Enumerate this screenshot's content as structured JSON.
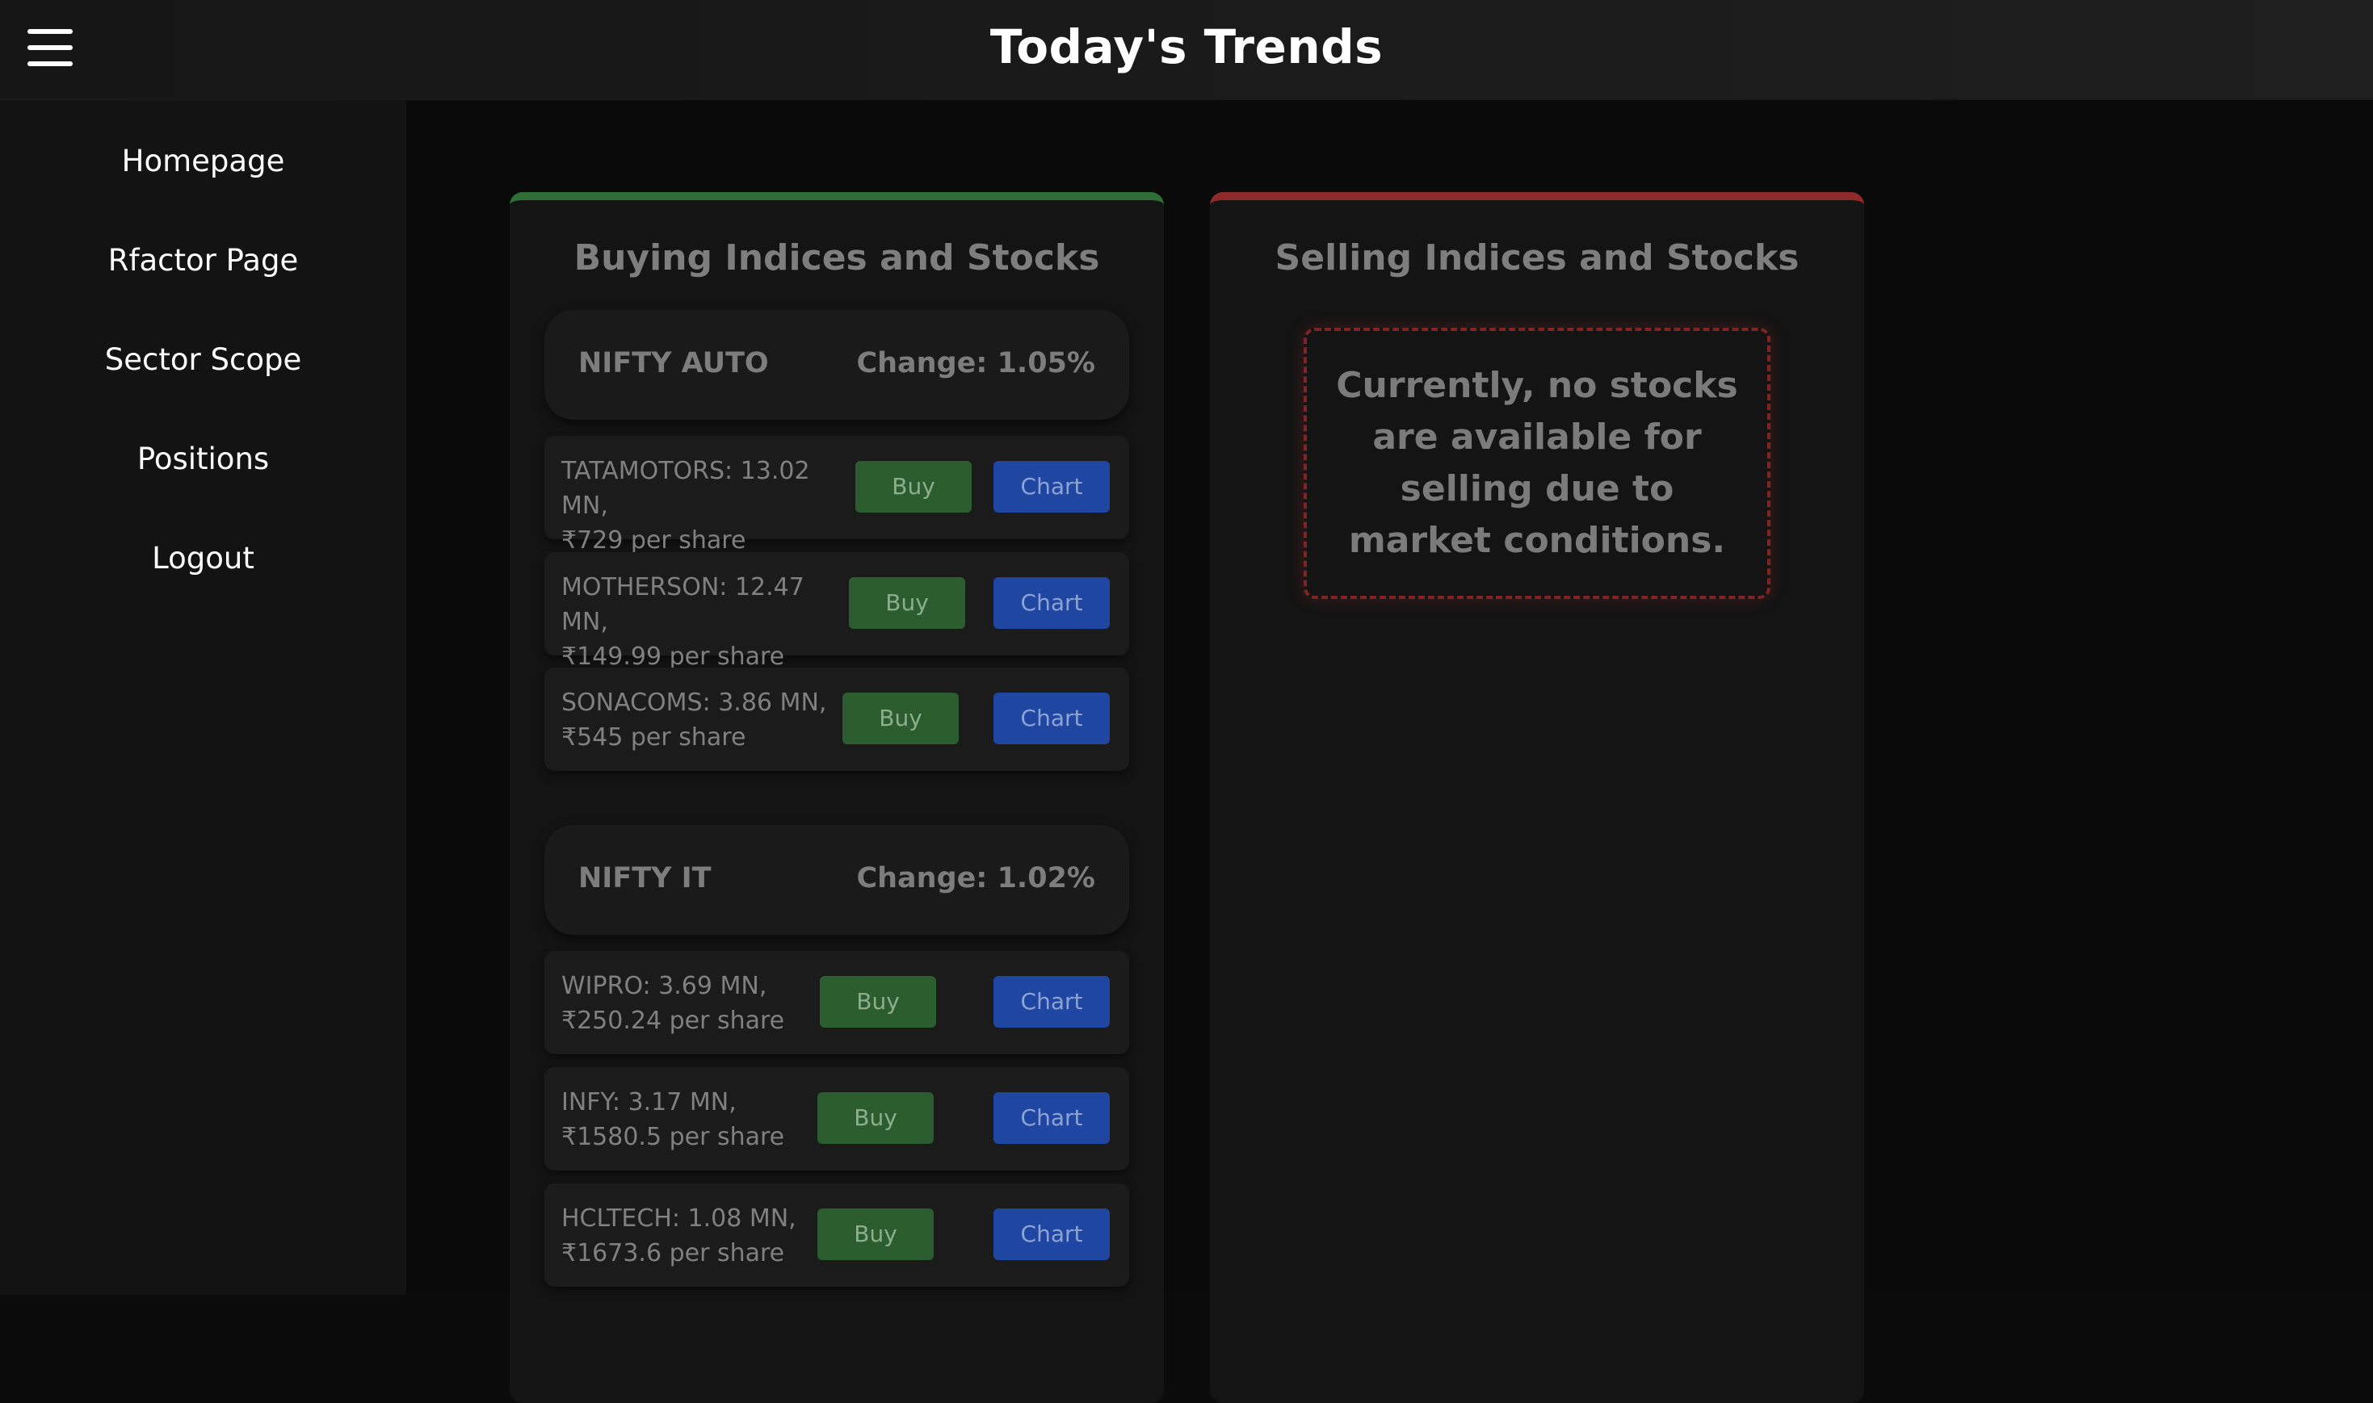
{
  "header": {
    "title": "Today's Trends",
    "menu_icon": "hamburger-menu-icon"
  },
  "sidebar": {
    "items": [
      {
        "label": "Homepage"
      },
      {
        "label": "Rfactor Page"
      },
      {
        "label": "Sector Scope"
      },
      {
        "label": "Positions"
      },
      {
        "label": "Logout"
      }
    ]
  },
  "buying": {
    "title": "Buying Indices and Stocks",
    "accent_color": "#2f6e37",
    "indices": [
      {
        "name": "NIFTY AUTO",
        "change": "Change: 1.05%",
        "stocks": [
          {
            "line1": "TATAMOTORS: 13.02 MN,",
            "line2": "₹729 per share",
            "buy": "Buy",
            "chart": "Chart"
          },
          {
            "line1": "MOTHERSON: 12.47 MN,",
            "line2": "₹149.99 per share",
            "buy": "Buy",
            "chart": "Chart"
          },
          {
            "line1": "SONACOMS: 3.86 MN,",
            "line2": "₹545 per share",
            "buy": "Buy",
            "chart": "Chart"
          }
        ]
      },
      {
        "name": "NIFTY IT",
        "change": "Change: 1.02%",
        "stocks": [
          {
            "line1": "WIPRO: 3.69 MN,",
            "line2": "₹250.24 per share",
            "buy": "Buy",
            "chart": "Chart"
          },
          {
            "line1": "INFY: 3.17 MN,",
            "line2": "₹1580.5 per share",
            "buy": "Buy",
            "chart": "Chart"
          },
          {
            "line1": "HCLTECH: 1.08 MN,",
            "line2": "₹1673.6 per share",
            "buy": "Buy",
            "chart": "Chart"
          }
        ]
      }
    ]
  },
  "selling": {
    "title": "Selling Indices and Stocks",
    "accent_color": "#8e2a2a",
    "empty_message": "Currently, no stocks are available for selling due to market conditions."
  },
  "colors": {
    "buy_button": "#2c5d2f",
    "chart_button": "#1f46a0"
  }
}
